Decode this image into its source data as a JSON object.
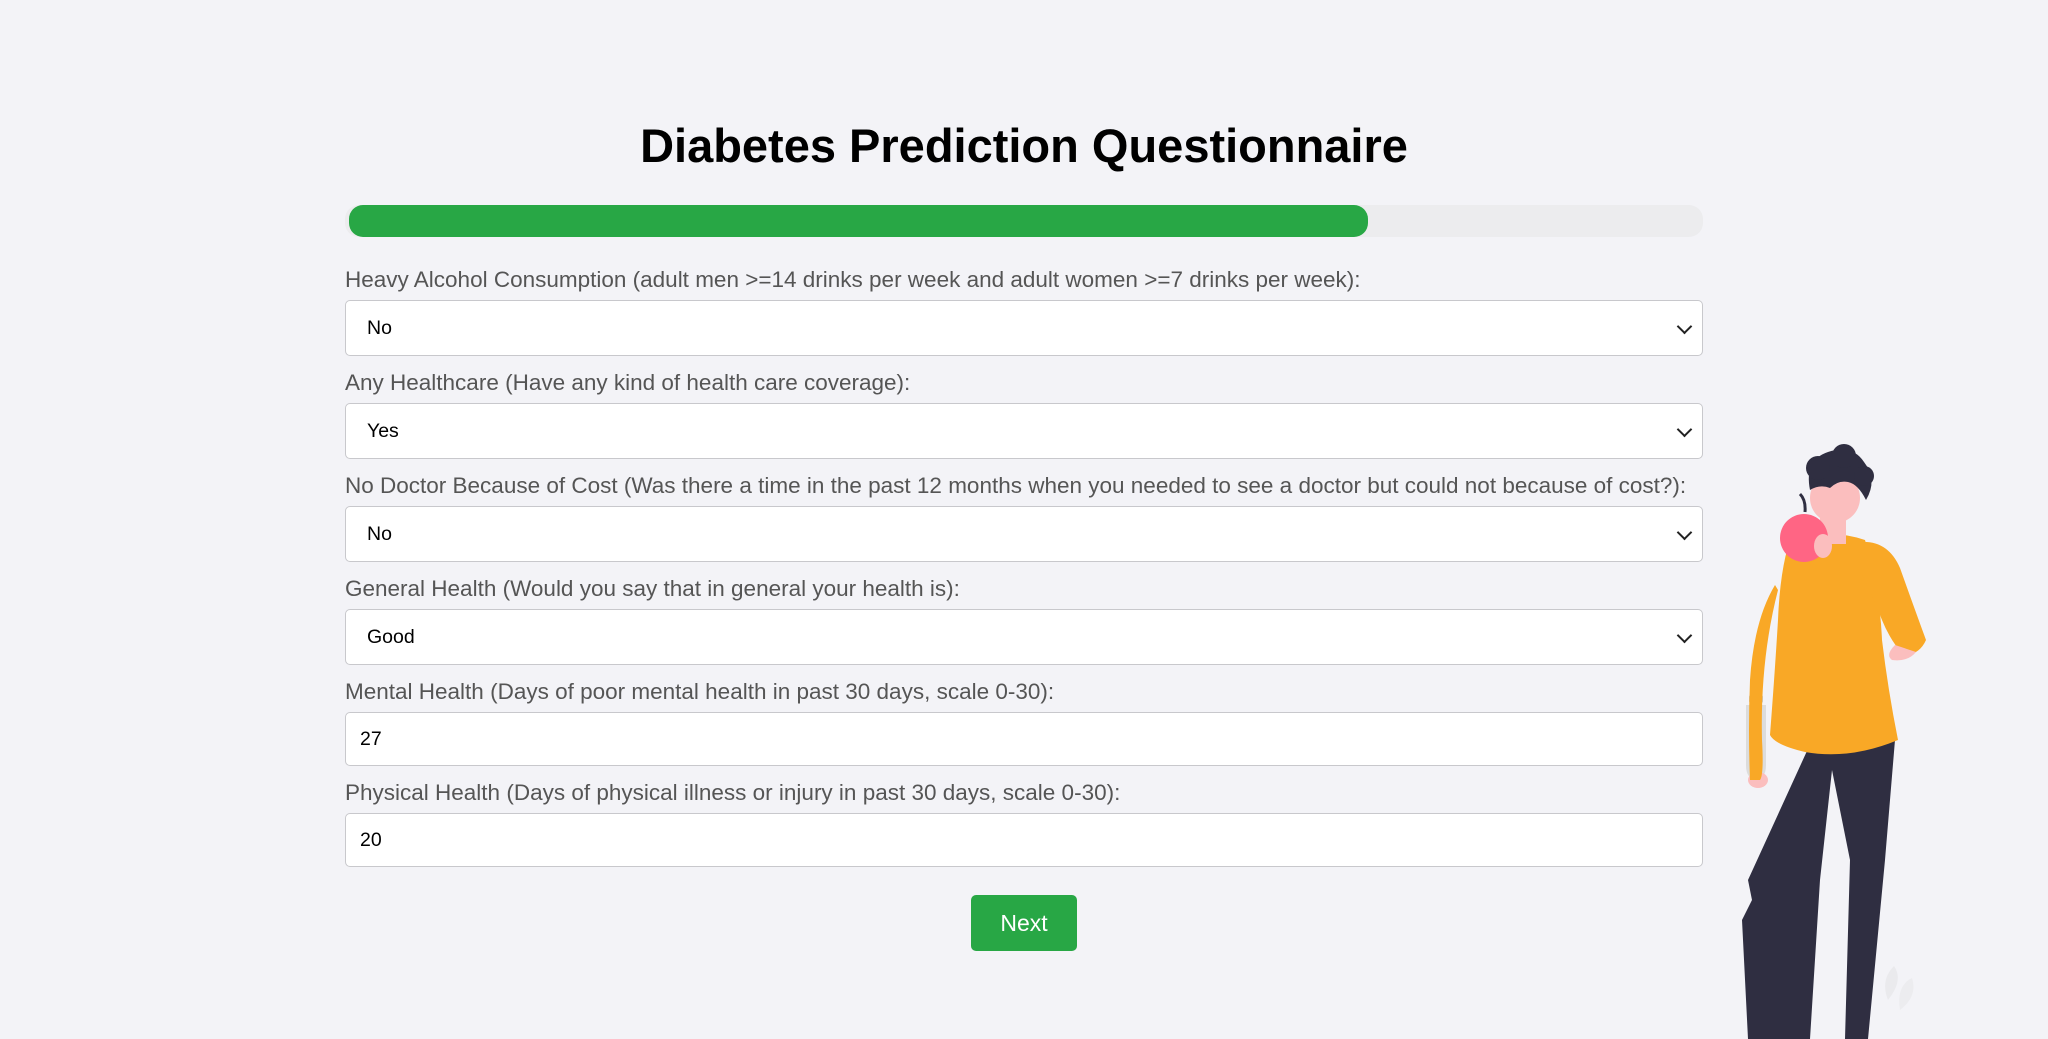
{
  "title": "Diabetes Prediction Questionnaire",
  "progress": {
    "percent": 75,
    "color": "#28a745"
  },
  "fields": [
    {
      "label": "Heavy Alcohol Consumption (adult men >=14 drinks per week and adult women >=7 drinks per week):",
      "type": "select",
      "value": "No"
    },
    {
      "label": "Any Healthcare (Have any kind of health care coverage):",
      "type": "select",
      "value": "Yes"
    },
    {
      "label": "No Doctor Because of Cost (Was there a time in the past 12 months when you needed to see a doctor but could not because of cost?):",
      "type": "select",
      "value": "No"
    },
    {
      "label": "General Health (Would you say that in general your health is):",
      "type": "select",
      "value": "Good"
    },
    {
      "label": "Mental Health (Days of poor mental health in past 30 days, scale 0-30):",
      "type": "number",
      "value": "27"
    },
    {
      "label": "Physical Health (Days of physical illness or injury in past 30 days, scale 0-30):",
      "type": "number",
      "value": "20"
    }
  ],
  "next_button": {
    "label": "Next"
  },
  "illustration": {
    "icon": "person-eating-apple-illustration",
    "shirt_color": "#f9a826",
    "pants_color": "#2f2e41",
    "apple_color": "#ff6584"
  }
}
